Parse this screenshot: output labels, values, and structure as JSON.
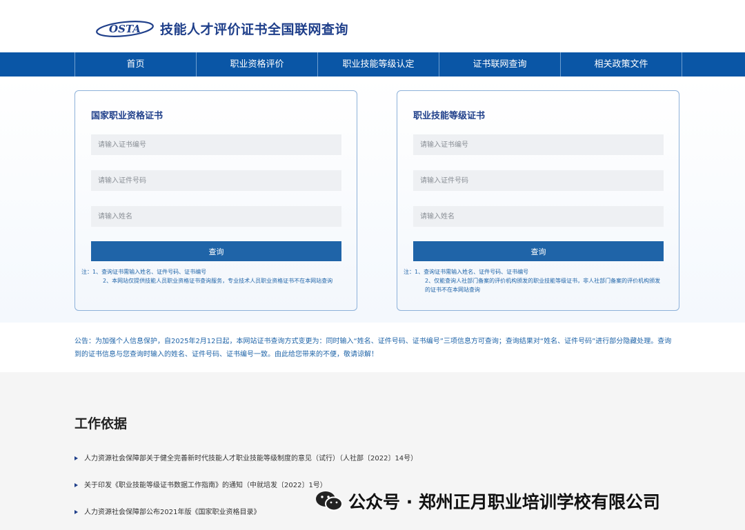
{
  "header": {
    "logo_text": "OSTA",
    "site_title": "技能人才评价证书全国联网查询"
  },
  "nav": [
    {
      "label": "首页"
    },
    {
      "label": "职业资格评价"
    },
    {
      "label": "职业技能等级认定"
    },
    {
      "label": "证书联网查询"
    },
    {
      "label": "相关政策文件"
    }
  ],
  "cards": [
    {
      "title": "国家职业资格证书",
      "placeholders": {
        "cert_no": "请输入证书编号",
        "id_no": "请输入证件号码",
        "name": "请输入姓名"
      },
      "button": "查询",
      "note_line1": "注：1、查询证书需输入姓名、证件号码、证书编号",
      "note_line2": "2、本网站仅提供技能人员职业资格证书查询服务，专业技术人员职业资格证书不在本网站查询"
    },
    {
      "title": "职业技能等级证书",
      "placeholders": {
        "cert_no": "请输入证书编号",
        "id_no": "请输入证件号码",
        "name": "请输入姓名"
      },
      "button": "查询",
      "note_line1": "注：1、查询证书需输入姓名、证件号码、证书编号",
      "note_line2": "2、仅能查询人社部门备案的评价机构颁发的职业技能等级证书，非人社部门备案的评价机构颁发的证书不在本网站查询"
    }
  ],
  "announcement": "公告：为加强个人信息保护，自2025年2月12日起，本网站证书查询方式变更为：同时输入“姓名、证件号码、证书编号”三项信息方可查询；查询结果对“姓名、证件号码”进行部分隐藏处理。查询到的证书信息与您查询时输入的姓名、证件号码、证书编号一致。由此给您带来的不便，敬请谅解！",
  "basis": {
    "title": "工作依据",
    "items": [
      "人力资源社会保障部关于健全完善新时代技能人才职业技能等级制度的意见（试行）（人社部〔2022〕14号）",
      "关于印发《职业技能等级证书数据工作指南》的通知（中就培发〔2022〕1号）",
      "人力资源社会保障部公布2021年版《国家职业资格目录》"
    ]
  },
  "watermark": {
    "text": "公众号 · 郑州正月职业培训学校有限公司",
    "icon": "wechat-icon"
  },
  "colors": {
    "nav_bg": "#0a56a6",
    "accent": "#1f64a8",
    "title_blue": "#1f3f8a"
  }
}
